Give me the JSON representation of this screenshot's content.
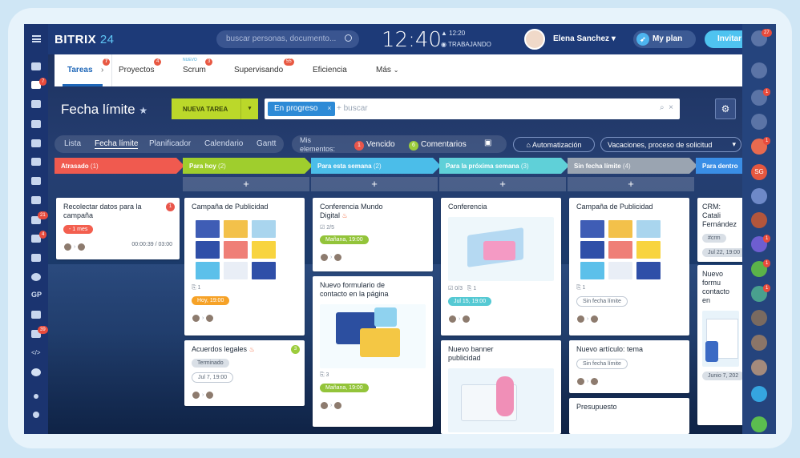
{
  "app": {
    "logo": "BITRIX",
    "logo_num": "24",
    "search_placeholder": "buscar personas, documento...",
    "clock": "12:40",
    "alarm": "12:20",
    "status": "TRABAJANDO",
    "user": "Elena Sanchez",
    "my_plan": "My plan",
    "invite": "Invitar"
  },
  "left_rail": {
    "gp_label": "GP",
    "badges": [
      "7",
      "21",
      "4",
      "39"
    ]
  },
  "right_rail": {
    "badges": [
      "27",
      "1",
      "1",
      "1",
      "1",
      "1"
    ],
    "initials": "SG"
  },
  "tabs": [
    {
      "label": "Tareas",
      "badge": "7"
    },
    {
      "label": "Proyectos",
      "badge": "4"
    },
    {
      "label": "Scrum",
      "badge": "3",
      "new": "NUEVO"
    },
    {
      "label": "Supervisando",
      "badge": "55"
    },
    {
      "label": "Eficiencia"
    },
    {
      "label": "Más"
    }
  ],
  "toolbar": {
    "title": "Fecha límite",
    "new_task": "NUEVA TAREA",
    "filter_chip": "En progreso",
    "filter_placeholder": "+ buscar"
  },
  "views": [
    "Lista",
    "Fecha límite",
    "Planificador",
    "Calendario",
    "Gantt"
  ],
  "mine": {
    "label": "Mis elementos:",
    "overdue_count": "1",
    "overdue_label": "Vencido",
    "comments_count": "6",
    "comments_label": "Comentarios"
  },
  "actions": {
    "automation": "Automatización",
    "vacations": "Vacaciones, proceso de solicitud"
  },
  "columns": [
    {
      "title": "Atrasado",
      "count": "(1)",
      "color": "#f05a4f"
    },
    {
      "title": "Para hoy",
      "count": "(2)",
      "color": "#9fce2d"
    },
    {
      "title": "Para esta semana",
      "count": "(2)",
      "color": "#4bbde9"
    },
    {
      "title": "Para la próxima semana",
      "count": "(3)",
      "color": "#5fd0d8"
    },
    {
      "title": "Sin fecha límite",
      "count": "(4)",
      "color": "#9aa4b1"
    },
    {
      "title": "Para dentro",
      "count": "",
      "color": "#3a8ee6"
    }
  ],
  "cards": {
    "c1": {
      "title": "Recolectar datos para la campaña",
      "badge": "1",
      "tag": "- 1 mes",
      "time": "00:00:39 / 03:00"
    },
    "c2": {
      "title": "Campaña de Publicidad",
      "meta": "1",
      "tag": "Hoy, 19:00"
    },
    "c3": {
      "title": "Acuerdos legales",
      "badge": "3",
      "tag": "Terminado",
      "date": "Jul 7, 19:00"
    },
    "c4": {
      "title": "Conferencia Mundo Digital",
      "meta": "2/5",
      "tag": "Mañana, 19:00"
    },
    "c5": {
      "title": "Nuevo formulario de contacto en la página",
      "meta": "3",
      "tag": "Mañana, 19:00"
    },
    "c6": {
      "title": "Conferencia",
      "meta1": "0/3",
      "meta2": "1",
      "tag": "Jul 15, 19:00"
    },
    "c7": {
      "title": "Nuevo banner publicidad"
    },
    "c8": {
      "title": "Campaña de Publicidad",
      "meta": "1",
      "tag": "Sin fecha límite"
    },
    "c9": {
      "title": "Nuevo artículo: tema",
      "tag": "Sin fecha límite"
    },
    "c10": {
      "title": "Presupuesto"
    },
    "c11": {
      "title": "CRM: Catali Fernández",
      "tag": "#crm",
      "date": "Jul 22, 19:00"
    },
    "c12": {
      "title": "Nuevo formu contacto en",
      "date": "Junio 7, 202"
    }
  }
}
